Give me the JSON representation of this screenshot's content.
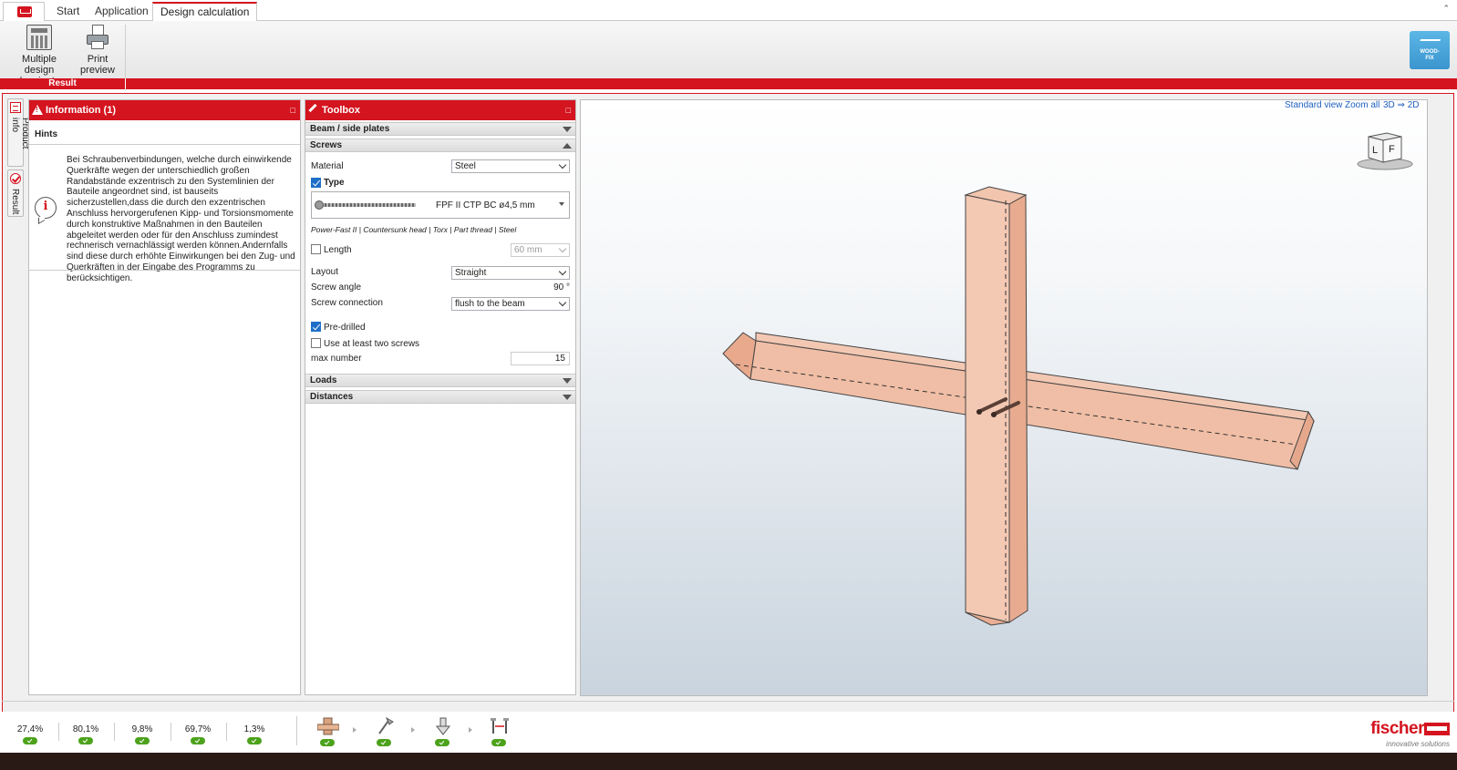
{
  "tabs": {
    "start": "Start",
    "application": "Application",
    "design_calculation": "Design calculation"
  },
  "ribbon": {
    "multiple_design_line1": "Multiple design",
    "multiple_design_line2": "/ variants",
    "print_line1": "Print",
    "print_line2": "preview",
    "group_label": "Result",
    "woodfix_label1": "WOOD-",
    "woodfix_label2": "FIX"
  },
  "side_tabs": {
    "product_info": "Product info",
    "result": "Result"
  },
  "information": {
    "title": "Information (1)",
    "hints_title": "Hints",
    "hint_text": "Bei Schraubenverbindungen, welche durch einwirkende Querkräfte wegen der unterschiedlich großen Randabstände exzentrisch zu den Systemlinien der Bauteile angeordnet sind, ist bauseits sicherzustellen,dass die durch den exzentrischen Anschluss hervorgerufenen Kipp- und Torsionsmomente durch konstruktive Maßnahmen in den Bauteilen abgeleitet werden oder für den Anschluss zumindest rechnerisch vernachlässigt werden können.Andernfalls sind diese durch erhöhte Einwirkungen bei den Zug- und Querkräften in der Eingabe des Programms zu berücksichtigen."
  },
  "toolbox": {
    "title": "Toolbox",
    "sections": {
      "beam": "Beam / side plates",
      "screws": "Screws",
      "loads": "Loads",
      "distances": "Distances"
    },
    "material_label": "Material",
    "material_value": "Steel",
    "type_label": "Type",
    "type_checked": true,
    "type_value": "FPF II CTP BC ø4,5 mm",
    "type_description": "Power-Fast II | Countersunk head | Torx | Part thread | Steel",
    "length_label": "Length",
    "length_checked": false,
    "length_value": "60 mm",
    "layout_label": "Layout",
    "layout_value": "Straight",
    "screw_angle_label": "Screw angle",
    "screw_angle_value": "90 °",
    "screw_connection_label": "Screw connection",
    "screw_connection_value": "flush to the beam",
    "predrilled_label": "Pre-drilled",
    "predrilled_checked": true,
    "two_screws_label": "Use at least two screws",
    "two_screws_checked": false,
    "max_number_label": "max number",
    "max_number_value": "15"
  },
  "viewport": {
    "standard_view": "Standard view",
    "zoom_all": "Zoom all",
    "toggle_3d_2d": "3D ⇒ 2D",
    "cube_face_left": "L",
    "cube_face_front": "F"
  },
  "status": {
    "utilizations": [
      "27,4%",
      "80,1%",
      "9,8%",
      "69,7%",
      "1,3%"
    ],
    "brand": "fischer",
    "tagline": "innovative solutions"
  },
  "colors": {
    "accent": "#d4141f",
    "ok": "#4ca21b",
    "link": "#1f5fbf",
    "wood": "#f0c0a8"
  }
}
